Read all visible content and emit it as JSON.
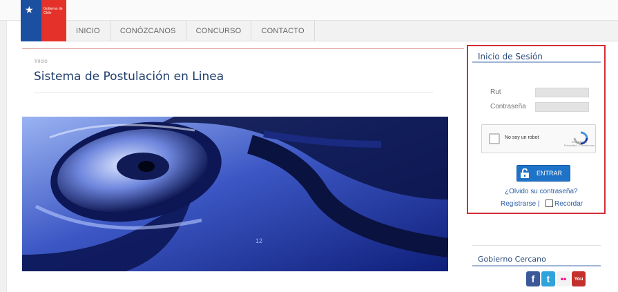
{
  "header": {
    "logo_text": "Gobierno de Chile",
    "nav": [
      {
        "label": "INICIO"
      },
      {
        "label": "CONÓZCANOS"
      },
      {
        "label": "CONCURSO"
      },
      {
        "label": "CONTACTO"
      }
    ]
  },
  "main": {
    "breadcrumb": "Inicio",
    "title": "Sistema de Postulación en Linea",
    "hero_number": "12"
  },
  "login": {
    "title": "Inicio de Sesión",
    "rut_label": "Rut",
    "password_label": "Contraseña",
    "captcha_text": "No soy un robot",
    "captcha_brand": "reCAPTCHA",
    "captcha_links": "Privacidad · Condiciones",
    "submit_label": "ENTRAR",
    "forgot_link": "¿Olvido su contraseña?",
    "register_link": "Registrarse |",
    "remember_label": "Recordar"
  },
  "sidebar": {
    "gob_title": "Gobierno Cercano",
    "social": [
      {
        "name": "facebook-icon",
        "glyph": "f",
        "color": "#3b5998"
      },
      {
        "name": "twitter-icon",
        "glyph": "t",
        "color": "#2fa3dc"
      },
      {
        "name": "flickr-icon",
        "glyph": "••",
        "color": "#ffffff"
      },
      {
        "name": "youtube-icon",
        "glyph": "You",
        "color": "#c4302b"
      }
    ]
  },
  "colors": {
    "brand_blue": "#1b4fa0",
    "brand_red": "#e4322b",
    "login_border": "#d12d36",
    "title_blue": "#1f3d6b",
    "button_blue": "#1e73c8"
  }
}
